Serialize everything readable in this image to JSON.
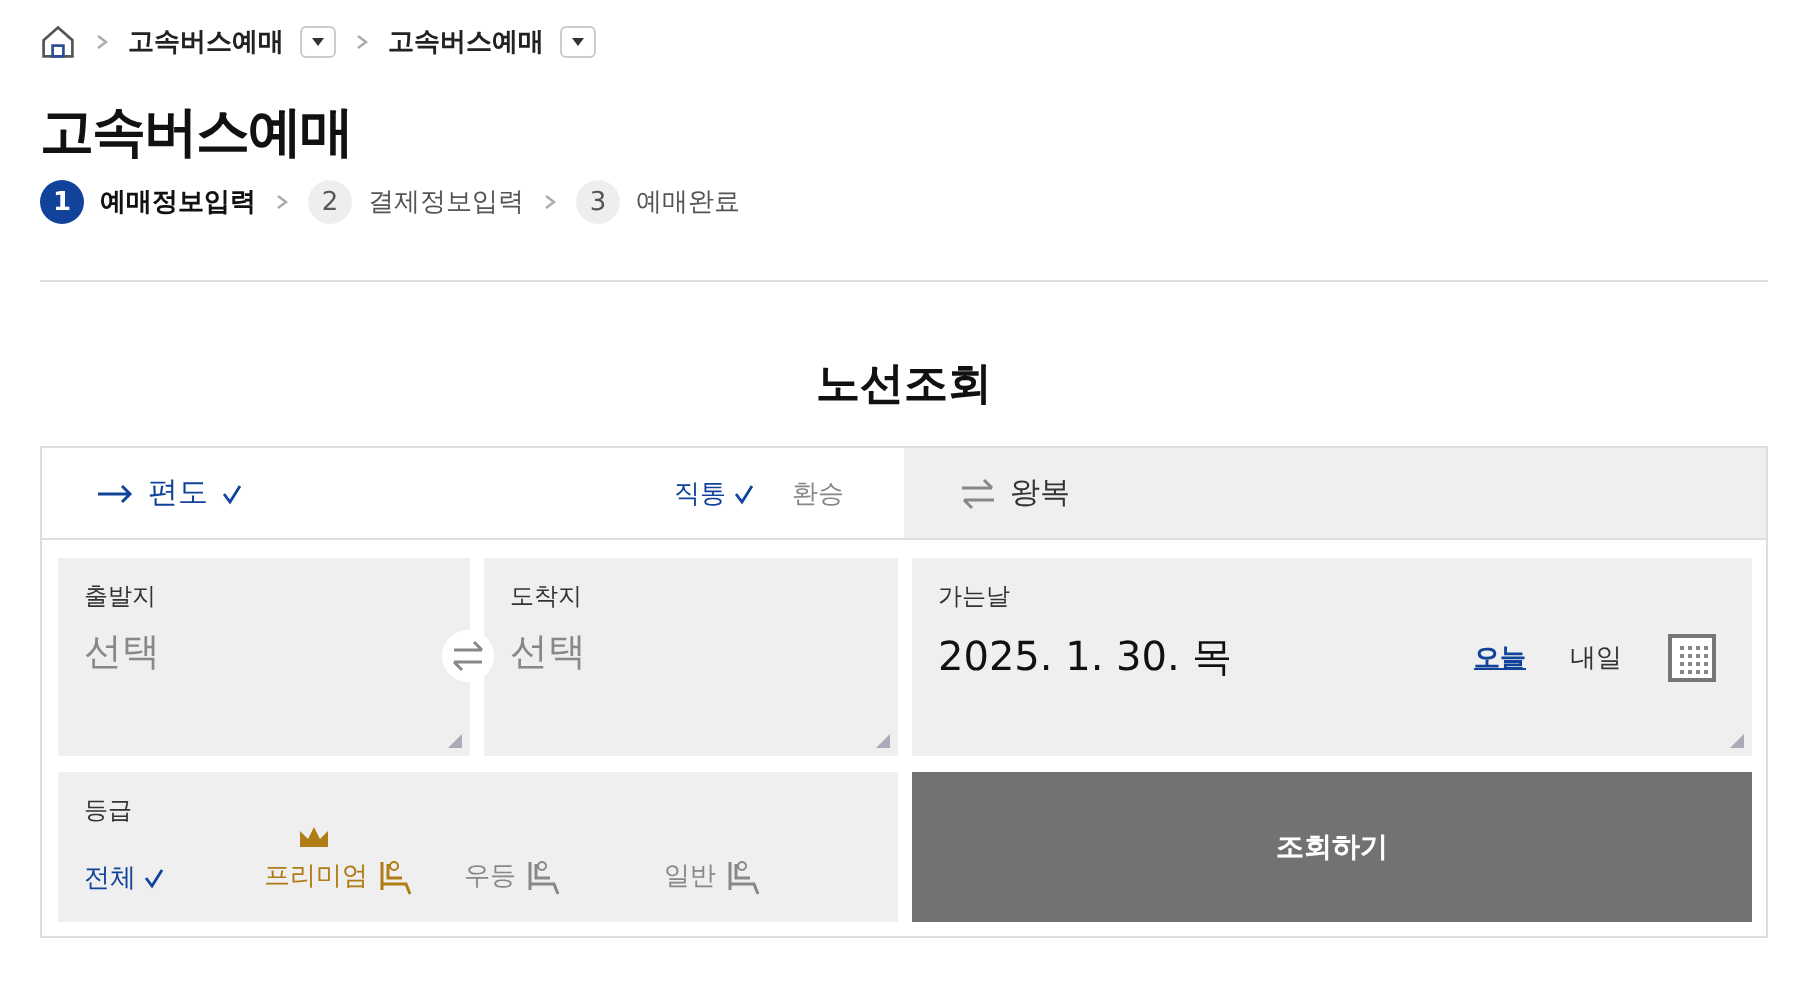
{
  "breadcrumb": [
    {
      "label": "고속버스예매",
      "has_dropdown": true
    },
    {
      "label": "고속버스예매",
      "has_dropdown": true
    }
  ],
  "title": "고속버스예매",
  "steps": [
    {
      "number": "1",
      "label": "예매정보입력",
      "selected": true
    },
    {
      "number": "2",
      "label": "결제정보입력",
      "selected": false
    },
    {
      "number": "3",
      "label": "예매완료",
      "selected": false
    }
  ],
  "section_title": "노선조회",
  "trip_tabs": [
    {
      "kind": "oneway",
      "label": "편도",
      "selected": true
    },
    {
      "kind": "round",
      "label": "왕복",
      "selected": false
    }
  ],
  "route_types": [
    {
      "label": "직통",
      "selected": true
    },
    {
      "label": "환승",
      "selected": false
    }
  ],
  "departure": {
    "label": "출발지",
    "placeholder": "선택"
  },
  "arrival": {
    "label": "도착지",
    "placeholder": "선택"
  },
  "date": {
    "label": "가는날",
    "value": "2025. 1. 30. 목",
    "options": [
      {
        "label": "오늘",
        "selected": true
      },
      {
        "label": "내일",
        "selected": false
      }
    ]
  },
  "grade": {
    "label": "등급",
    "options": [
      {
        "kind": "all",
        "label": "전체",
        "selected": true
      },
      {
        "kind": "premium",
        "label": "프리미엄",
        "selected": false
      },
      {
        "kind": "excellent",
        "label": "우등",
        "selected": false
      },
      {
        "kind": "regular",
        "label": "일반",
        "selected": false
      }
    ]
  },
  "search_button": "조회하기"
}
